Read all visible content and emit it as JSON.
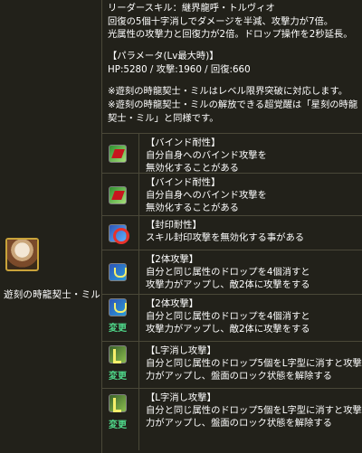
{
  "character": {
    "name": "遊刻の時龍契士・ミル"
  },
  "leader_skill": {
    "lines": [
      "リーダースキル：継界龍呼・トルヴィオ",
      "回復の5個十字消しでダメージを半減、攻撃力が7倍。",
      "光属性の攻撃力と回復力が2倍。ドロップ操作を2秒延長。"
    ],
    "params_title": "【パラメータ(Lv最大時)】",
    "params": "HP:5280 / 攻撃:1960 / 回復:660",
    "notes": [
      "※遊刻の時龍契士・ミルはレベル限界突破に対応します。",
      "※遊刻の時龍契士・ミルの解放できる超覚醒は「星刻の時龍",
      "契士・ミル」と同様です。"
    ]
  },
  "awakenings": [
    {
      "icon": "bind-resist-icon",
      "title": "【バインド耐性】",
      "lines": [
        "自分自身へのバインド攻撃を",
        "無効化することがある"
      ],
      "changed": false
    },
    {
      "icon": "bind-resist-icon",
      "title": "【バインド耐性】",
      "lines": [
        "自分自身へのバインド攻撃を",
        "無効化することがある"
      ],
      "changed": false
    },
    {
      "icon": "seal-resist-icon",
      "title": "【封印耐性】",
      "lines": [
        "スキル封印攻撃を無効化する事がある"
      ],
      "changed": false
    },
    {
      "icon": "two-pronged-attack-icon",
      "title": "【2体攻撃】",
      "lines": [
        "自分と同じ属性のドロップを4個消すと",
        "攻撃力がアップし、敵2体に攻撃をする"
      ],
      "changed": false
    },
    {
      "icon": "two-pronged-attack-icon",
      "title": "【2体攻撃】",
      "lines": [
        "自分と同じ属性のドロップを4個消すと",
        "攻撃力がアップし、敵2体に攻撃をする"
      ],
      "changed": true
    },
    {
      "icon": "l-shape-attack-icon",
      "title": "【L字消し攻撃】",
      "lines": [
        "自分と同じ属性のドロップ5個をL字型に消すと攻撃",
        "力がアップし、盤面のロック状態を解除する"
      ],
      "changed": true
    },
    {
      "icon": "l-shape-attack-icon",
      "title": "【L字消し攻撃】",
      "lines": [
        "自分と同じ属性のドロップ5個をL字型に消すと攻撃",
        "力がアップし、盤面のロック状態を解除する"
      ],
      "changed": true
    }
  ],
  "change_label": "変更",
  "colors": {
    "background": "#22211a",
    "border": "#4a4838",
    "change_text": "#4fd88a"
  }
}
